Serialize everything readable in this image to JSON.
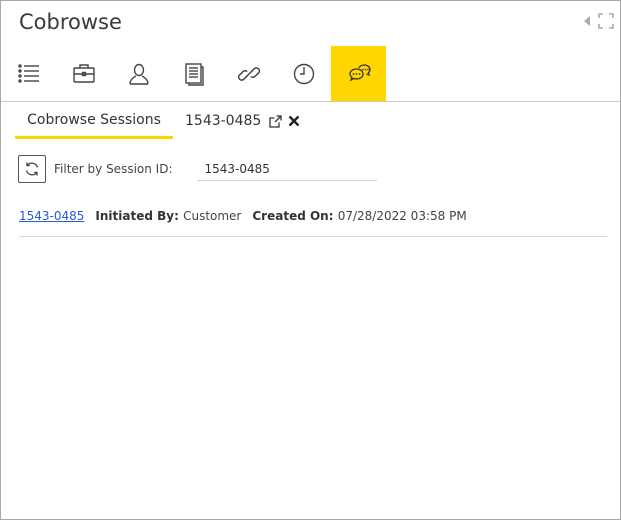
{
  "window": {
    "title": "Cobrowse"
  },
  "toolbar": {
    "icons": [
      {
        "name": "list-icon",
        "active": false
      },
      {
        "name": "briefcase-icon",
        "active": false
      },
      {
        "name": "user-icon",
        "active": false
      },
      {
        "name": "document-icon",
        "active": false
      },
      {
        "name": "link-icon",
        "active": false
      },
      {
        "name": "clock-icon",
        "active": false
      },
      {
        "name": "chat-bubbles-icon",
        "active": true
      }
    ],
    "active_color": "#ffd600"
  },
  "tabs": {
    "main_label": "Cobrowse Sessions",
    "session_label": "1543-0485"
  },
  "filter": {
    "label": "Filter by Session ID:",
    "value": "1543-0485"
  },
  "session": {
    "id": "1543-0485",
    "initiated_by_label": "Initiated By:",
    "initiated_by_value": "Customer",
    "created_on_label": "Created On:",
    "created_on_value": "07/28/2022 03:58 PM",
    "link_color": "#2a5ad6"
  }
}
